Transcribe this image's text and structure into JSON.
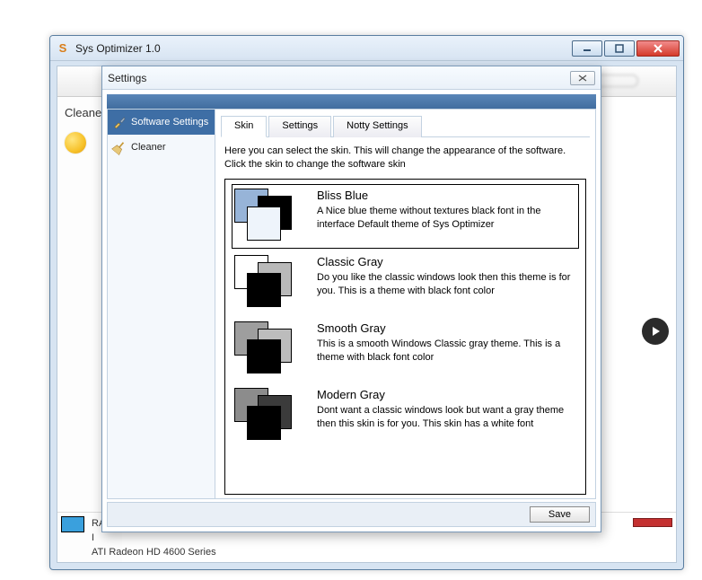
{
  "outer": {
    "title": "Sys Optimizer 1.0",
    "sidebar_title": "Cleane",
    "info_label": "i",
    "status": {
      "line1": "RA",
      "line2": "I",
      "line3": "ATI Radeon HD 4600 Series"
    }
  },
  "dialog": {
    "title": "Settings",
    "nav": [
      {
        "label": "Software Settings"
      },
      {
        "label": "Cleaner"
      }
    ],
    "tabs": [
      {
        "label": "Skin"
      },
      {
        "label": "Settings"
      },
      {
        "label": "Notty Settings"
      }
    ],
    "intro_line1": "Here you can select the skin. This will change the appearance of the software.",
    "intro_line2": "Click the skin to change the software skin",
    "skins": [
      {
        "title": "Bliss Blue",
        "desc": "A Nice blue theme without textures black font in the interface Default theme of Sys Optimizer"
      },
      {
        "title": "Classic Gray",
        "desc": "Do you like the classic windows look then this theme is for you. This is a theme with black font color"
      },
      {
        "title": "Smooth Gray",
        "desc": "This is a smooth Windows Classic gray theme. This is a theme with black font color"
      },
      {
        "title": "Modern Gray",
        "desc": "Dont want a classic windows look but want a gray theme then this skin is for you. This skin has a white font"
      }
    ],
    "save_label": "Save"
  }
}
